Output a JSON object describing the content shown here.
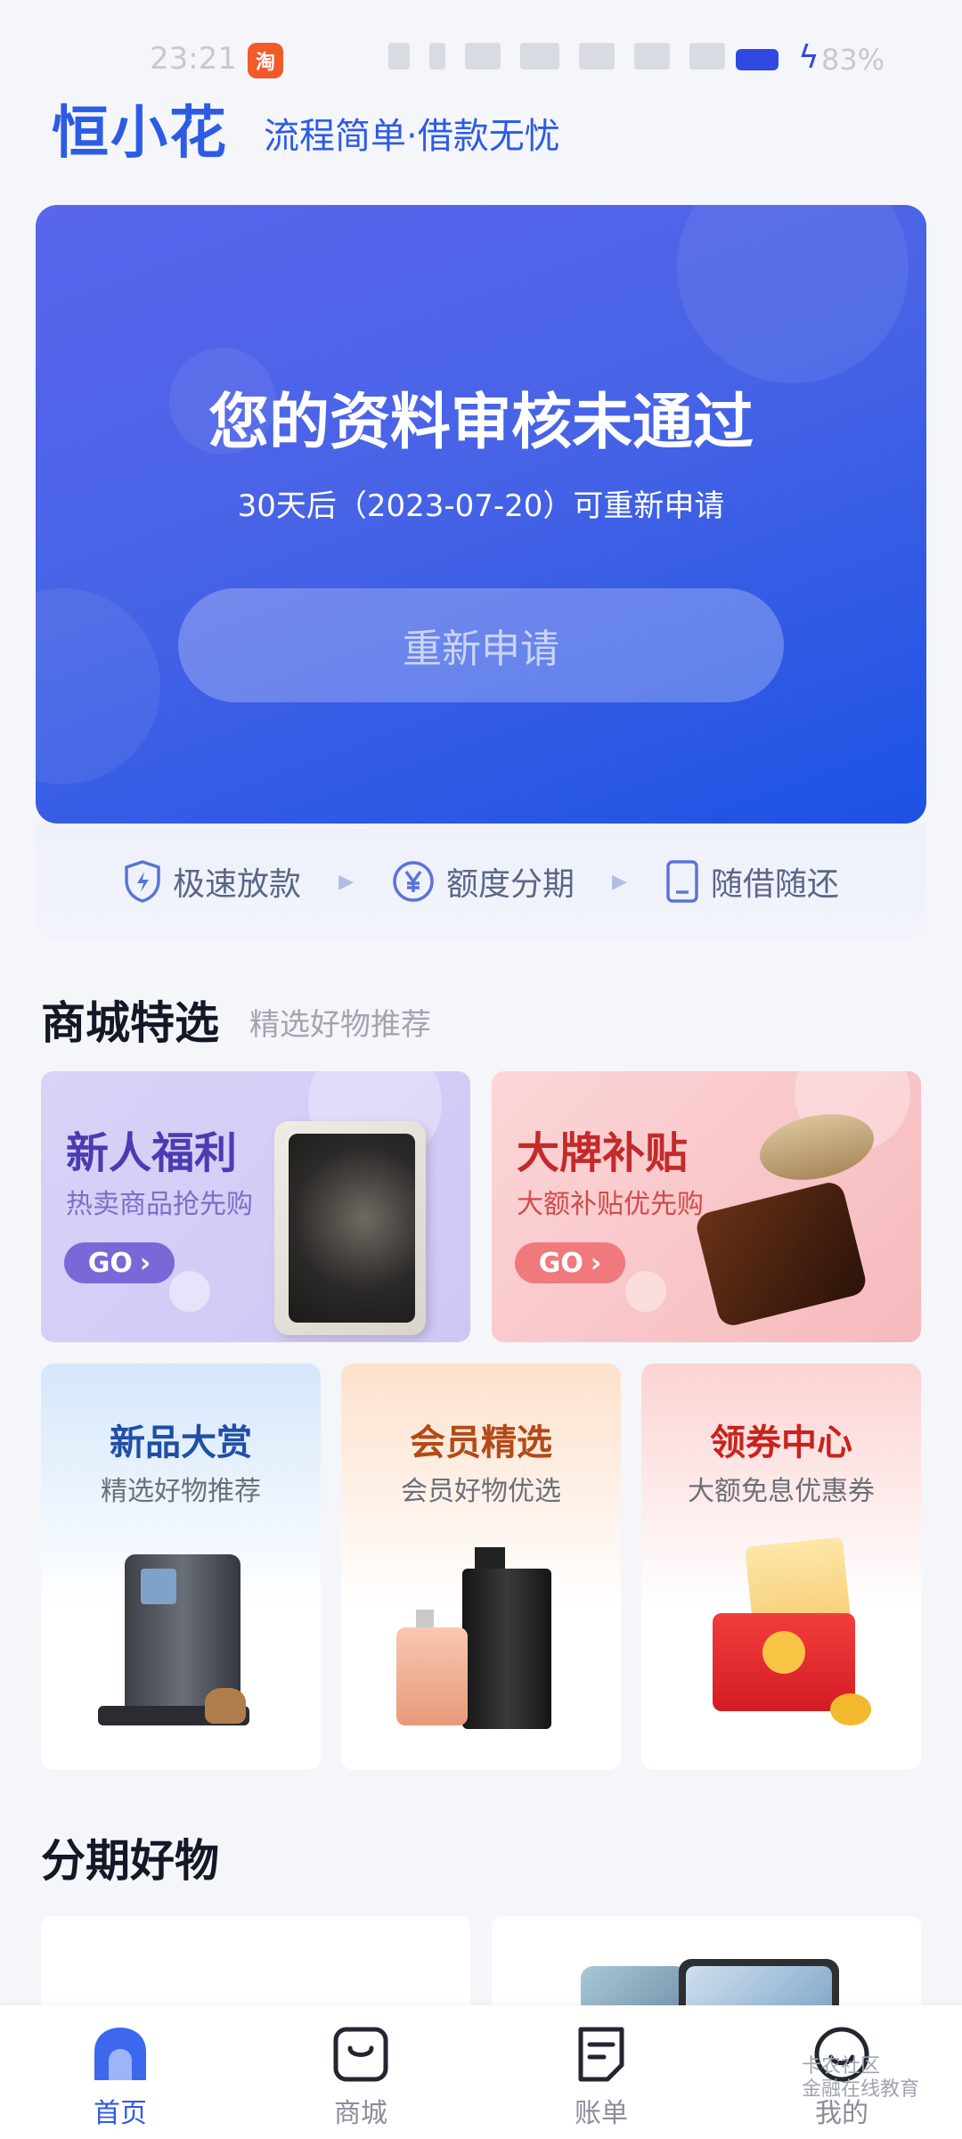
{
  "status_bar": {
    "time": "23:21",
    "app_icon_label": "淘",
    "battery": "83%"
  },
  "header": {
    "logo": "恒小花",
    "slogan": "流程简单·借款无忧"
  },
  "hero": {
    "title": "您的资料审核未通过",
    "subtitle": "30天后（2023-07-20）可重新申请",
    "button": "重新申请",
    "colors": {
      "start": "#5a66ec",
      "end": "#1c52e4"
    }
  },
  "features": [
    {
      "icon": "shield-bolt-icon",
      "label": "极速放款"
    },
    {
      "icon": "yen-circle-icon",
      "label": "额度分期"
    },
    {
      "icon": "phone-icon",
      "label": "随借随还"
    }
  ],
  "mall": {
    "title": "商城特选",
    "subtitle": "精选好物推荐",
    "promos": [
      {
        "title": "新人福利",
        "subtitle": "热卖商品抢先购",
        "go": "GO",
        "image": "tablet-image"
      },
      {
        "title": "大牌补贴",
        "subtitle": "大额补贴优先购",
        "go": "GO",
        "image": "skincare-jar-image"
      }
    ],
    "categories": [
      {
        "title": "新品大赏",
        "subtitle": "精选好物推荐",
        "image": "coffee-machine-image",
        "color": "#1f4fa6"
      },
      {
        "title": "会员精选",
        "subtitle": "会员好物优选",
        "image": "perfume-image",
        "color": "#b34a17"
      },
      {
        "title": "领券中心",
        "subtitle": "大额免息优惠券",
        "image": "coupon-red-envelope-image",
        "color": "#c8231c"
      }
    ]
  },
  "installment": {
    "title": "分期好物"
  },
  "bottom_nav": [
    {
      "label": "首页",
      "icon": "home-icon",
      "active": true
    },
    {
      "label": "商城",
      "icon": "shopping-bag-icon",
      "active": false
    },
    {
      "label": "账单",
      "icon": "bill-icon",
      "active": false
    },
    {
      "label": "我的",
      "icon": "profile-icon",
      "active": false
    }
  ],
  "watermark": {
    "line1": "卡农社区",
    "line2": "金融在线教育"
  }
}
